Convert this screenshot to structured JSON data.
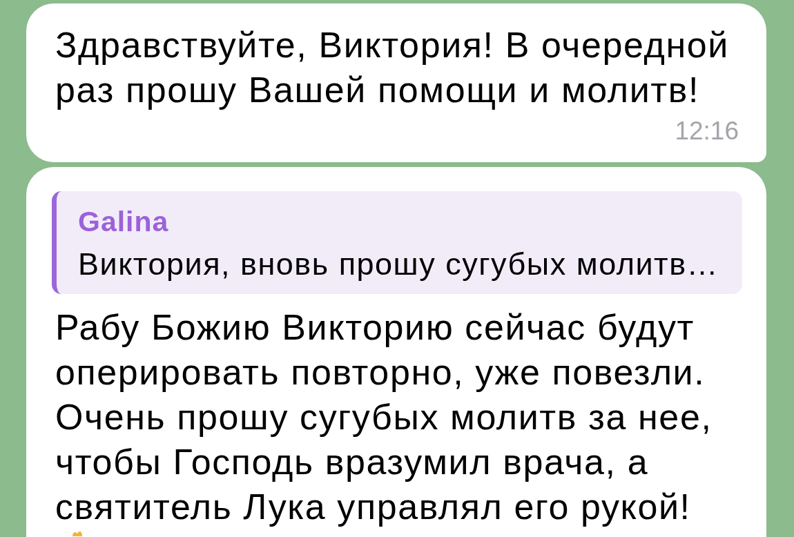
{
  "messages": [
    {
      "kind": "text",
      "text": "Здравствуйте, Виктория! В очередной\nраз прошу Вашей помощи и молитв!",
      "time": "12:16"
    },
    {
      "kind": "reply",
      "reply_to": {
        "author": "Galina",
        "text": "Виктория, вновь прошу сугубых молитв…"
      },
      "text": "Рабу Божию Викторию сейчас будут\nоперировать повторно, уже повезли.\nОчень прошу сугубых молитв за нее,\nчтобы Господь вразумил врача, а\nсвятитель Лука управлял его рукой!",
      "emoji": true
    }
  ]
}
